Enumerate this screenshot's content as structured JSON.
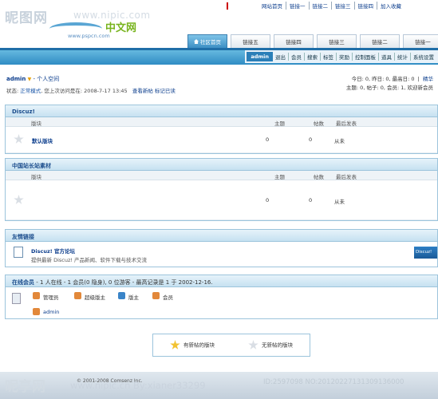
{
  "watermark": {
    "site_cn": "昵图网",
    "url": "www.nipic.com",
    "bottom_cn": "昵享网",
    "bottom_url": "www.nipic.cn",
    "user": "xianer33299",
    "id_text": "ID:2597098 NO:20120227131309136000"
  },
  "logo": {
    "cn": "中文网",
    "site": "www.pspcn.com"
  },
  "topnav": [
    "网站首页",
    "链接一",
    "链接二",
    "链接三",
    "链接四",
    "加入收藏"
  ],
  "tabs": [
    {
      "label": "社区首页",
      "active": true
    },
    {
      "label": "链接五"
    },
    {
      "label": "链接四"
    },
    {
      "label": "链接三"
    },
    {
      "label": "链接二"
    },
    {
      "label": "链接一"
    }
  ],
  "menu": [
    "admin",
    "退出",
    "会员",
    "搜索",
    "标签",
    "奖励",
    "控制面板",
    "道具",
    "统计",
    "系统设置"
  ],
  "user": {
    "name": "admin",
    "space": "- 个人空间",
    "status_prefix": "状态:",
    "status_mode": "正常模式",
    "status_rest": ", 您上次访问是在: 2008-7-17 13:45",
    "view_new": "查看新帖",
    "mark_read": "标记已读"
  },
  "stats": {
    "line1": "今日: 0, 昨日: 0, 最高日: 0",
    "line1_link": "精华",
    "line2": "主题: 0, 帖子: 0, 会员: 1, 欢迎新会员"
  },
  "columns": {
    "forum": "版块",
    "threads": "主题",
    "posts": "帖数",
    "lastpost": "最后发表"
  },
  "forums": [
    {
      "category": "Discuz!",
      "name": "默认版块",
      "threads": "0",
      "posts": "0",
      "lastpost": "从未"
    },
    {
      "category": "中国站长站素材",
      "name": "",
      "threads": "0",
      "posts": "0",
      "lastpost": "从未"
    }
  ],
  "links": {
    "title": "友情链接",
    "name": "Discuz! 官方论坛",
    "desc": "提供最新 Discuz! 产品新闻、软件下载与技术交流",
    "badge": "Discuz!"
  },
  "online": {
    "title": "在线会员",
    "summary": " - 1 人在线 - 1 会员(0 隐身), 0 位游客 - 最高记录是 1 于 2002-12-16.",
    "legend": [
      {
        "label": "管理员",
        "color": "#e2883a"
      },
      {
        "label": "超级版主",
        "color": "#e2883a"
      },
      {
        "label": "版主",
        "color": "#3a84c8"
      },
      {
        "label": "会员",
        "color": "#e2883a"
      }
    ],
    "users": [
      "admin"
    ]
  },
  "legend": {
    "new": "有新帖的版块",
    "none": "无新帖的版块"
  },
  "footer": {
    "copy": "© 2001-2008 Comsenz Inc."
  }
}
